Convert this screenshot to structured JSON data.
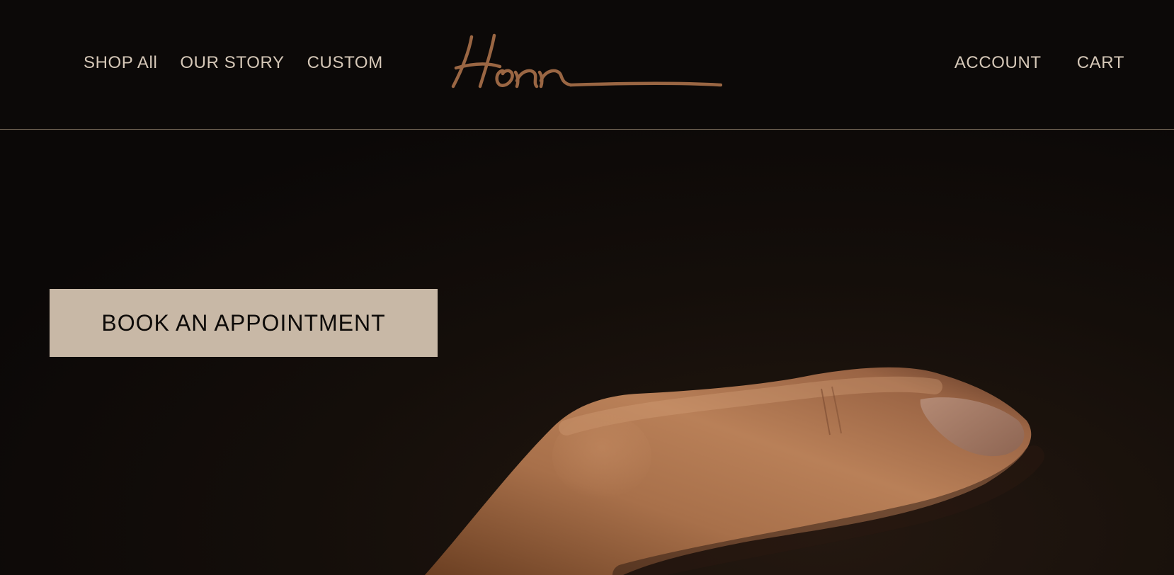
{
  "nav": {
    "left": [
      {
        "label": "SHOP All"
      },
      {
        "label": "OUR STORY"
      },
      {
        "label": "CUSTOM"
      }
    ],
    "right": [
      {
        "label": "ACCOUNT"
      },
      {
        "label": "CART"
      }
    ]
  },
  "logo": {
    "text": "Honn",
    "color": "#9a6643"
  },
  "hero": {
    "cta_label": "BOOK AN APPOINTMENT",
    "cta_color": "#c8b8a6",
    "image": "finger-close-up"
  },
  "colors": {
    "background": "#0b0807",
    "nav_text": "#d6c8b8",
    "divider": "#8a7a68"
  }
}
